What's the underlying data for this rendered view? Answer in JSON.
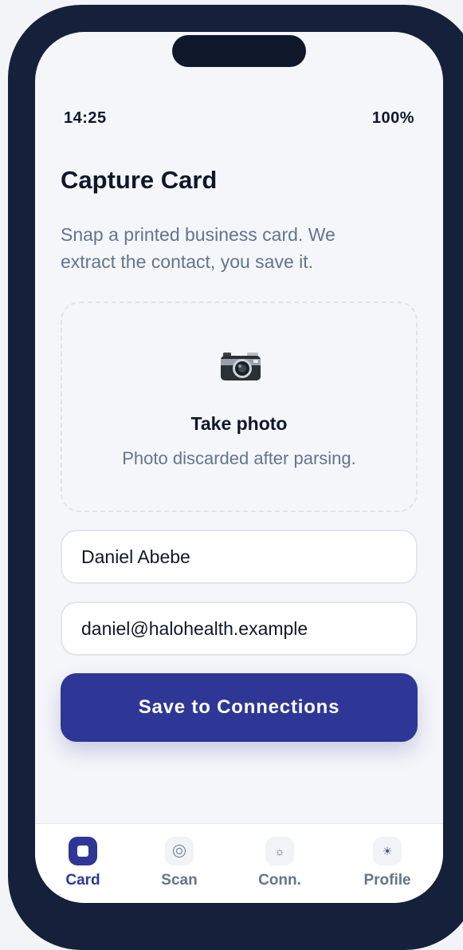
{
  "status_bar": {
    "time": "14:25",
    "battery": "100%"
  },
  "page": {
    "title": "Capture Card",
    "subtitle": "Snap a printed business card. We extract the contact, you save it."
  },
  "capture": {
    "icon": "camera-icon",
    "title": "Take photo",
    "subtitle": "Photo discarded after parsing."
  },
  "form": {
    "name_value": "Daniel Abebe",
    "email_value": "daniel@halohealth.example",
    "save_label": "Save to Connections"
  },
  "tabs": [
    {
      "label": "Card",
      "icon": "card-icon",
      "active": true
    },
    {
      "label": "Scan",
      "icon": "scan-icon",
      "active": false
    },
    {
      "label": "Conn.",
      "icon": "connections-icon",
      "active": false
    },
    {
      "label": "Profile",
      "icon": "profile-icon",
      "active": false
    }
  ],
  "colors": {
    "accent": "#2e3795",
    "frame": "#15203a",
    "screen_bg": "#f5f6fa",
    "text_primary": "#0f172a",
    "text_secondary": "#64748b"
  }
}
